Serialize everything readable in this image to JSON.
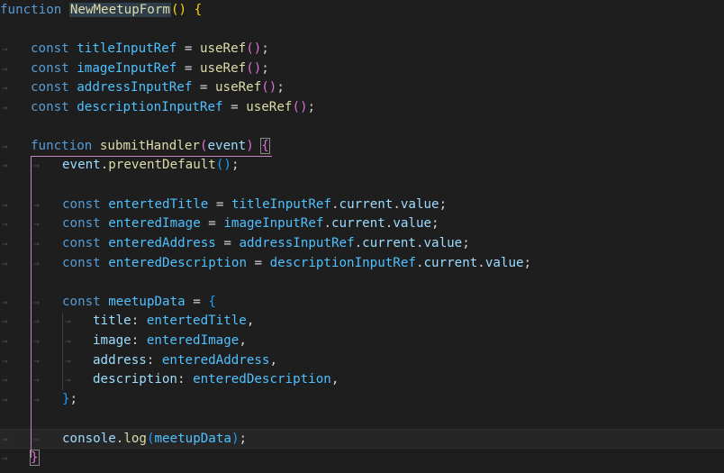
{
  "editor": {
    "lines": [
      {
        "tokens": [
          [
            "kw",
            "function"
          ],
          [
            "op",
            " "
          ],
          [
            "fn",
            "NewMeetupForm"
          ],
          [
            "p1",
            "()"
          ],
          [
            "op",
            " "
          ],
          [
            "p1",
            "{"
          ]
        ]
      },
      {
        "tokens": []
      },
      {
        "tokens": [
          [
            "kw",
            "const"
          ],
          [
            "op",
            " "
          ],
          [
            "cst",
            "titleInputRef"
          ],
          [
            "op",
            " = "
          ],
          [
            "fn",
            "useRef"
          ],
          [
            "p2",
            "()"
          ],
          [
            "op",
            ";"
          ]
        ]
      },
      {
        "tokens": [
          [
            "kw",
            "const"
          ],
          [
            "op",
            " "
          ],
          [
            "cst",
            "imageInputRef"
          ],
          [
            "op",
            " = "
          ],
          [
            "fn",
            "useRef"
          ],
          [
            "p2",
            "()"
          ],
          [
            "op",
            ";"
          ]
        ]
      },
      {
        "tokens": [
          [
            "kw",
            "const"
          ],
          [
            "op",
            " "
          ],
          [
            "cst",
            "addressInputRef"
          ],
          [
            "op",
            " = "
          ],
          [
            "fn",
            "useRef"
          ],
          [
            "p2",
            "()"
          ],
          [
            "op",
            ";"
          ]
        ]
      },
      {
        "tokens": [
          [
            "kw",
            "const"
          ],
          [
            "op",
            " "
          ],
          [
            "cst",
            "descriptionInputRef"
          ],
          [
            "op",
            " = "
          ],
          [
            "fn",
            "useRef"
          ],
          [
            "p2",
            "()"
          ],
          [
            "op",
            ";"
          ]
        ]
      },
      {
        "tokens": []
      },
      {
        "tokens": [
          [
            "kw",
            "function"
          ],
          [
            "op",
            " "
          ],
          [
            "fn",
            "submitHandler"
          ],
          [
            "p2",
            "("
          ],
          [
            "var",
            "event"
          ],
          [
            "p2",
            ")"
          ],
          [
            "op",
            " "
          ],
          [
            "p2",
            "{"
          ]
        ]
      },
      {
        "tokens": [
          [
            "var",
            "event"
          ],
          [
            "op",
            "."
          ],
          [
            "fn",
            "preventDefault"
          ],
          [
            "p3",
            "()"
          ],
          [
            "op",
            ";"
          ]
        ]
      },
      {
        "tokens": []
      },
      {
        "tokens": [
          [
            "kw",
            "const"
          ],
          [
            "op",
            " "
          ],
          [
            "cst",
            "entertedTitle"
          ],
          [
            "op",
            " = "
          ],
          [
            "cst",
            "titleInputRef"
          ],
          [
            "op",
            "."
          ],
          [
            "var",
            "current"
          ],
          [
            "op",
            "."
          ],
          [
            "var",
            "value"
          ],
          [
            "op",
            ";"
          ]
        ]
      },
      {
        "tokens": [
          [
            "kw",
            "const"
          ],
          [
            "op",
            " "
          ],
          [
            "cst",
            "enteredImage"
          ],
          [
            "op",
            " = "
          ],
          [
            "cst",
            "imageInputRef"
          ],
          [
            "op",
            "."
          ],
          [
            "var",
            "current"
          ],
          [
            "op",
            "."
          ],
          [
            "var",
            "value"
          ],
          [
            "op",
            ";"
          ]
        ]
      },
      {
        "tokens": [
          [
            "kw",
            "const"
          ],
          [
            "op",
            " "
          ],
          [
            "cst",
            "enteredAddress"
          ],
          [
            "op",
            " = "
          ],
          [
            "cst",
            "addressInputRef"
          ],
          [
            "op",
            "."
          ],
          [
            "var",
            "current"
          ],
          [
            "op",
            "."
          ],
          [
            "var",
            "value"
          ],
          [
            "op",
            ";"
          ]
        ]
      },
      {
        "tokens": [
          [
            "kw",
            "const"
          ],
          [
            "op",
            " "
          ],
          [
            "cst",
            "enteredDescription"
          ],
          [
            "op",
            " = "
          ],
          [
            "cst",
            "descriptionInputRef"
          ],
          [
            "op",
            "."
          ],
          [
            "var",
            "current"
          ],
          [
            "op",
            "."
          ],
          [
            "var",
            "value"
          ],
          [
            "op",
            ";"
          ]
        ]
      },
      {
        "tokens": []
      },
      {
        "tokens": [
          [
            "kw",
            "const"
          ],
          [
            "op",
            " "
          ],
          [
            "cst",
            "meetupData"
          ],
          [
            "op",
            " = "
          ],
          [
            "p3",
            "{"
          ]
        ]
      },
      {
        "tokens": [
          [
            "var",
            "title"
          ],
          [
            "op",
            ": "
          ],
          [
            "cst",
            "entertedTitle"
          ],
          [
            "op",
            ","
          ]
        ]
      },
      {
        "tokens": [
          [
            "var",
            "image"
          ],
          [
            "op",
            ": "
          ],
          [
            "cst",
            "enteredImage"
          ],
          [
            "op",
            ","
          ]
        ]
      },
      {
        "tokens": [
          [
            "var",
            "address"
          ],
          [
            "op",
            ": "
          ],
          [
            "cst",
            "enteredAddress"
          ],
          [
            "op",
            ","
          ]
        ]
      },
      {
        "tokens": [
          [
            "var",
            "description"
          ],
          [
            "op",
            ": "
          ],
          [
            "cst",
            "enteredDescription"
          ],
          [
            "op",
            ","
          ]
        ]
      },
      {
        "tokens": [
          [
            "p3",
            "}"
          ],
          [
            "op",
            ";"
          ]
        ]
      },
      {
        "tokens": []
      },
      {
        "tokens": [
          [
            "var",
            "console"
          ],
          [
            "op",
            "."
          ],
          [
            "fn",
            "log"
          ],
          [
            "p3",
            "("
          ],
          [
            "cst",
            "meetupData"
          ],
          [
            "p3",
            ")"
          ],
          [
            "op",
            ";"
          ]
        ]
      },
      {
        "tokens": [
          [
            "p2",
            "}"
          ]
        ]
      }
    ]
  },
  "colors": {
    "background": "#1e1e1e",
    "keyword": "#569cd6",
    "function": "#dcdcaa",
    "variable": "#9cdcfe",
    "constant": "#4fc1ff",
    "bracket_level1": "#ffd700",
    "bracket_level2": "#da70d6",
    "bracket_level3": "#179fff",
    "indent_guide_active": "#c586c0"
  },
  "icons": {
    "whitespace_tab": "tab-arrow-icon"
  }
}
